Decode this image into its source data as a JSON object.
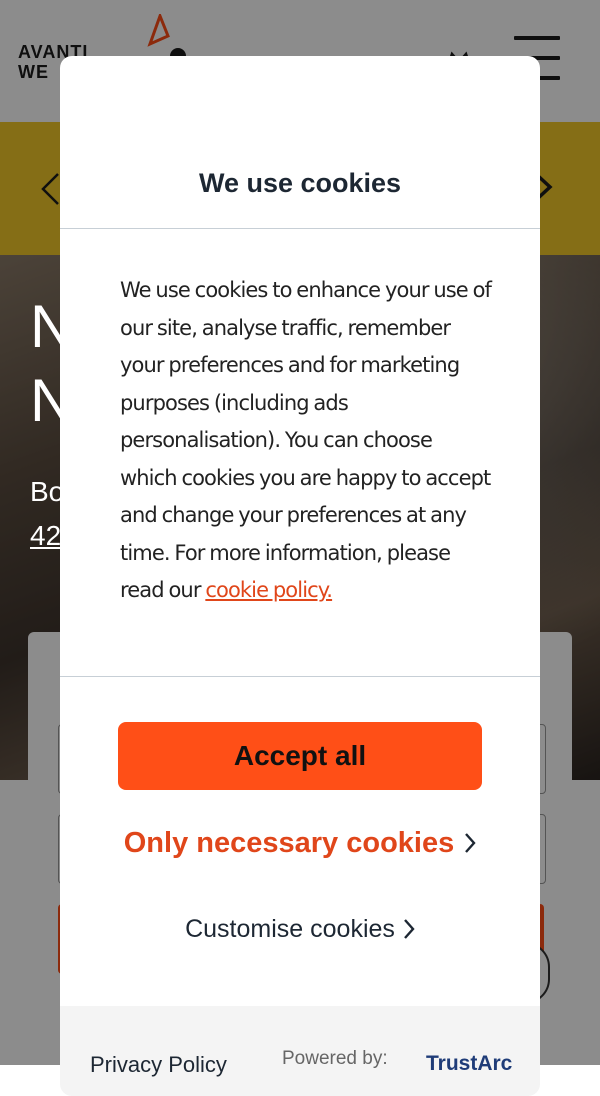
{
  "site": {
    "logo_line1": "AVANTI",
    "logo_line2": "WE",
    "hero_title": "N\nN",
    "hero_subtitle": "Bo",
    "hero_link": "42"
  },
  "cookie_modal": {
    "title": "We use cookies",
    "body": "We use cookies to enhance your use of our site, analyse traffic, remember your preferences and for marketing purposes (including ads personalisation). You can choose which cookies you are happy to accept and change your preferences at any time. For more information, please read our ",
    "policy_link": "cookie policy.",
    "accept_label": "Accept all",
    "necessary_label": "Only necessary cookies",
    "customise_label": "Customise cookies",
    "footer": {
      "privacy_label": "Privacy Policy",
      "powered_by": "Powered by:",
      "brand": "TrustArc"
    }
  },
  "colors": {
    "accent_orange": "#ff4f17",
    "promo_yellow": "#f3c829",
    "link_orange": "#e0461a"
  }
}
